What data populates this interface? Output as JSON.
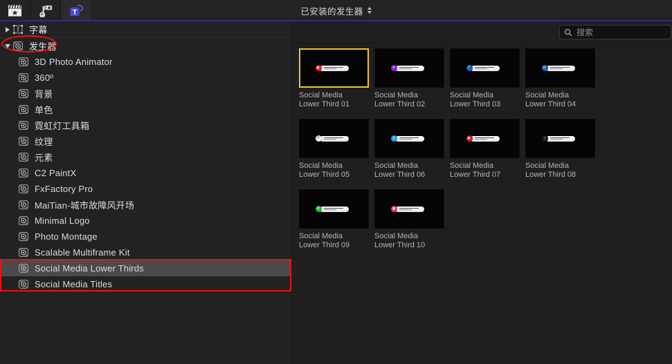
{
  "window": {
    "title": "已安装的发生器",
    "title_selector_icon": "chevron-up-down-icon"
  },
  "toolbar": {
    "buttons": [
      {
        "name": "titles-and-generators-browser",
        "icon": "clapperboard-star-icon",
        "active": false
      },
      {
        "name": "photos-and-audio-browser",
        "icon": "music-photo-icon",
        "active": false
      },
      {
        "name": "titles-browser",
        "icon": "blue-title-t-icon",
        "active": true
      }
    ]
  },
  "search": {
    "placeholder": "搜索",
    "value": "",
    "icon": "search-icon"
  },
  "sidebar": {
    "groups": [
      {
        "label": "字幕",
        "expanded": false,
        "icon": "titles-icon",
        "name": "sidebar-group-titles"
      },
      {
        "label": "发生器",
        "expanded": true,
        "icon": "generator-icon",
        "name": "sidebar-group-generators"
      }
    ],
    "items": [
      {
        "label": "3D Photo Animator",
        "icon": "generator-icon",
        "selected": false
      },
      {
        "label": "360º",
        "icon": "generator-icon",
        "selected": false
      },
      {
        "label": "背景",
        "icon": "generator-icon",
        "selected": false
      },
      {
        "label": "单色",
        "icon": "generator-icon",
        "selected": false
      },
      {
        "label": "霓虹灯工具箱",
        "icon": "generator-icon",
        "selected": false
      },
      {
        "label": "纹理",
        "icon": "generator-icon",
        "selected": false
      },
      {
        "label": "元素",
        "icon": "generator-icon",
        "selected": false
      },
      {
        "label": "C2 PaintX",
        "icon": "generator-icon",
        "selected": false
      },
      {
        "label": "FxFactory Pro",
        "icon": "generator-icon",
        "selected": false
      },
      {
        "label": "MaiTian-城市故障风开场",
        "icon": "generator-icon",
        "selected": false
      },
      {
        "label": "Minimal Logo",
        "icon": "generator-icon",
        "selected": false
      },
      {
        "label": "Photo Montage",
        "icon": "generator-icon",
        "selected": false
      },
      {
        "label": "Scalable Multiframe Kit",
        "icon": "generator-icon",
        "selected": false
      },
      {
        "label": "Social Media Lower Thirds",
        "icon": "generator-icon",
        "selected": true
      },
      {
        "label": "Social Media Titles",
        "icon": "generator-icon",
        "selected": false
      }
    ]
  },
  "grid": {
    "items": [
      {
        "line1": "Social Media",
        "line2": "Lower Third 01",
        "badge_color": "#e8222a",
        "badge_glyph": "▶",
        "selected": true
      },
      {
        "line1": "Social Media",
        "line2": "Lower Third 02",
        "badge_color": "#8a27d6",
        "badge_glyph": "✦",
        "selected": false
      },
      {
        "line1": "Social Media",
        "line2": "Lower Third 03",
        "badge_color": "#1a5fc4",
        "badge_glyph": "f",
        "selected": false
      },
      {
        "line1": "Social Media",
        "line2": "Lower Third 04",
        "badge_color": "#1766b5",
        "badge_glyph": "in",
        "selected": false
      },
      {
        "line1": "Social Media",
        "line2": "Lower Third 05",
        "badge_color": "#f2f2f2",
        "badge_glyph": "P",
        "selected": false
      },
      {
        "line1": "Social Media",
        "line2": "Lower Third 06",
        "badge_color": "#2aa3e0",
        "badge_glyph": "v",
        "selected": false
      },
      {
        "line1": "Social Media",
        "line2": "Lower Third 07",
        "badge_color": "#e01b22",
        "badge_glyph": "▶",
        "selected": false
      },
      {
        "line1": "Social Media",
        "line2": "Lower Third 08",
        "badge_color": "#1a1a28",
        "badge_glyph": "♪",
        "selected": false
      },
      {
        "line1": "Social Media",
        "line2": "Lower Third 09",
        "badge_color": "#2cb742",
        "badge_glyph": "✆",
        "selected": false
      },
      {
        "line1": "Social Media",
        "line2": "Lower Third 10",
        "badge_color": "#e0407f",
        "badge_glyph": "◉",
        "selected": false
      }
    ]
  },
  "annotations": {
    "ellipse_target": "发生器",
    "rect_targets": [
      "Social Media Lower Thirds",
      "Social Media Titles"
    ],
    "color": "#ee1111"
  },
  "colors": {
    "toolbar_bg": "#232323",
    "sidebar_bg": "#222222",
    "panel_bg": "#1f1f1f",
    "selection_gray": "#4a4a4a",
    "selection_yellow": "#f2c12e",
    "tab_underline": "#2e2e7a",
    "annotation_red": "#ee1111"
  }
}
